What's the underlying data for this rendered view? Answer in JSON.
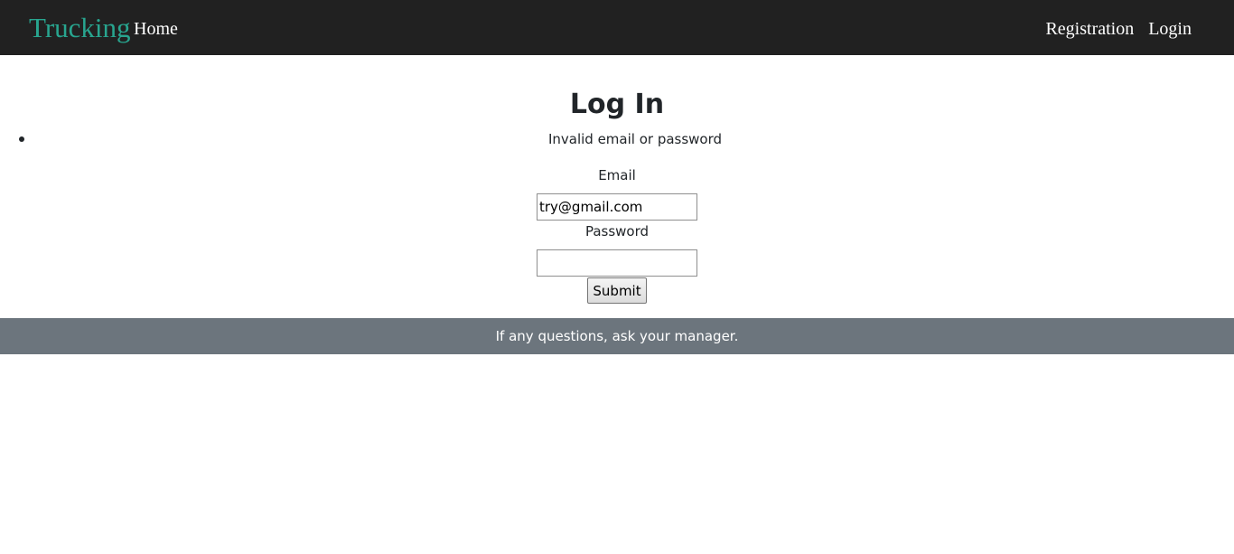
{
  "navbar": {
    "brand": "Trucking",
    "home": "Home",
    "registration": "Registration",
    "login": "Login",
    "brand_color": "#28a58f",
    "background": "#212121"
  },
  "page": {
    "title": "Log In"
  },
  "errors": [
    "Invalid email or password"
  ],
  "form": {
    "email_label": "Email",
    "email_value": "try@gmail.com",
    "password_label": "Password",
    "password_value": "",
    "submit_label": "Submit"
  },
  "footer": {
    "text": "If any questions, ask your manager.",
    "background": "#6c757d"
  }
}
